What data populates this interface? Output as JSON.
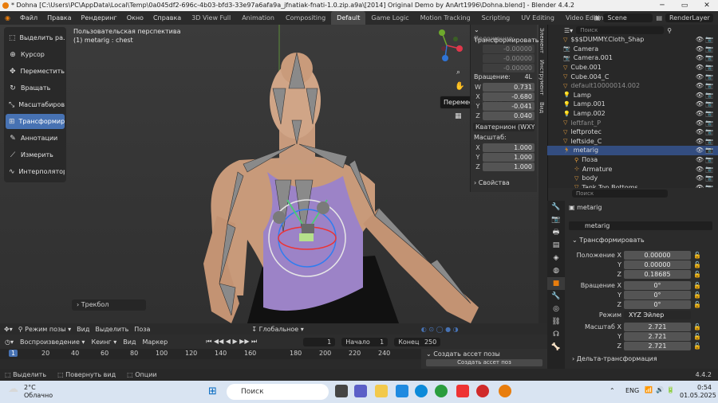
{
  "window": {
    "title": "* Dohna [C:\\Users\\PC\\AppData\\Local\\Temp\\0a045df2-696c-4b03-bfd3-33e97a6afa9a_jfnatiak-fnati-1.0.zip.a9a\\[2014] Original Demo by AnArt1996\\Dohna.blend] - Blender 4.4.2"
  },
  "menu": [
    "Файл",
    "Правка",
    "Рендеринг",
    "Окно",
    "Справка"
  ],
  "workspaces": [
    "3D View Full",
    "Animation",
    "Compositing",
    "Default",
    "Game Logic",
    "Motion Tracking",
    "Scripting",
    "UV Editing",
    "Video Editing"
  ],
  "scene": {
    "name": "Scene",
    "layer": "RenderLayer"
  },
  "viewport": {
    "view_name": "Пользовательская перспектива",
    "object_info": "(1) metarig : chest",
    "tooltip": "Переместить вид",
    "trackball": "Трекбол"
  },
  "tools": [
    "Выделить ра...",
    "Курсор",
    "Переместить",
    "Вращать",
    "Масштабиров...",
    "Трансформир...",
    "Аннотации",
    "Измерить",
    "Интерполятор"
  ],
  "npanel": {
    "header": "Трансформировать",
    "location_label": "Положение:",
    "location": [
      "-0.00000",
      "-0.00000",
      "-0.00000"
    ],
    "rotation_label": "Вращение:",
    "rotation_mode_short": "4L",
    "rotation": [
      {
        "axis": "W",
        "value": "0.731"
      },
      {
        "axis": "X",
        "value": "-0.680"
      },
      {
        "axis": "Y",
        "value": "-0.041"
      },
      {
        "axis": "Z",
        "value": "0.040"
      }
    ],
    "rotation_mode": "Кватернион (WXYZ)",
    "scale_label": "Масштаб:",
    "scale": [
      {
        "axis": "X",
        "value": "1.000"
      },
      {
        "axis": "Y",
        "value": "1.000"
      },
      {
        "axis": "Z",
        "value": "1.000"
      }
    ],
    "properties": "Свойства",
    "side_tabs": [
      "Элемент",
      "Инструмент",
      "Вид"
    ]
  },
  "vpheader": {
    "mode": "Режим позы",
    "view": "Вид",
    "select": "Выделить",
    "pose": "Поза",
    "orientation": "Глобальное"
  },
  "timeline": {
    "playback": "Воспроизведение",
    "keying": "Кеинг",
    "view": "Вид",
    "marker": "Маркер",
    "current_frame": "1",
    "start_label": "Начало",
    "start": "1",
    "end_label": "Конец",
    "end": "250",
    "ticks": [
      "1",
      "20",
      "40",
      "60",
      "80",
      "100",
      "120",
      "140",
      "160",
      "180",
      "200",
      "220",
      "240"
    ]
  },
  "asset": {
    "panel": "Создать ассет позы",
    "button": "Создать ассет поз"
  },
  "status": {
    "select": "Выделить",
    "rotate": "Повернуть вид",
    "options": "Опции",
    "version": "4.4.2"
  },
  "outliner": {
    "search_placeholder": "Поиск",
    "items": [
      {
        "name": "$$$DUMMY.Cloth_Shap",
        "dim": false,
        "sel": false
      },
      {
        "name": "Camera",
        "dim": false,
        "sel": false
      },
      {
        "name": "Camera.001",
        "dim": false,
        "sel": false
      },
      {
        "name": "Cube.001",
        "dim": false,
        "sel": false
      },
      {
        "name": "Cube.004_C",
        "dim": false,
        "sel": false
      },
      {
        "name": "default10000014.002",
        "dim": true,
        "sel": false
      },
      {
        "name": "Lamp",
        "dim": false,
        "sel": false
      },
      {
        "name": "Lamp.001",
        "dim": false,
        "sel": false
      },
      {
        "name": "Lamp.002",
        "dim": false,
        "sel": false
      },
      {
        "name": "leftfant_P",
        "dim": true,
        "sel": false
      },
      {
        "name": "leftprotec",
        "dim": false,
        "sel": false
      },
      {
        "name": "leftside_C",
        "dim": false,
        "sel": false
      },
      {
        "name": "metarig",
        "dim": false,
        "sel": true
      },
      {
        "name": "Поза",
        "dim": false,
        "sel": false
      },
      {
        "name": "Armature",
        "dim": false,
        "sel": false
      },
      {
        "name": "body",
        "dim": false,
        "sel": false
      },
      {
        "name": "Tank Top Bottoms",
        "dim": false,
        "sel": false
      }
    ]
  },
  "properties": {
    "search_placeholder": "Поиск",
    "object": "metarig",
    "object_field": "metarig",
    "transform": "Трансформировать",
    "location": [
      {
        "label": "Положение X",
        "value": "0.00000"
      },
      {
        "label": "Y",
        "value": "0.00000"
      },
      {
        "label": "Z",
        "value": "0.18685"
      }
    ],
    "rotation": [
      {
        "label": "Вращение X",
        "value": "0°"
      },
      {
        "label": "Y",
        "value": "0°"
      },
      {
        "label": "Z",
        "value": "0°"
      }
    ],
    "mode_label": "Режим",
    "mode": "XYZ Эйлер",
    "scale": [
      {
        "label": "Масштаб X",
        "value": "2.721"
      },
      {
        "label": "Y",
        "value": "2.721"
      },
      {
        "label": "Z",
        "value": "2.721"
      }
    ],
    "delta": "Дельта-трансформация"
  },
  "taskbar": {
    "weather_temp": "2°C",
    "weather_desc": "Облачно",
    "search": "Поиск",
    "lang": "ENG",
    "time": "0:54",
    "date": "01.05.2025"
  },
  "colors": {
    "accent": "#4772b3",
    "selection": "#334d80",
    "orange": "#e87d0d"
  }
}
